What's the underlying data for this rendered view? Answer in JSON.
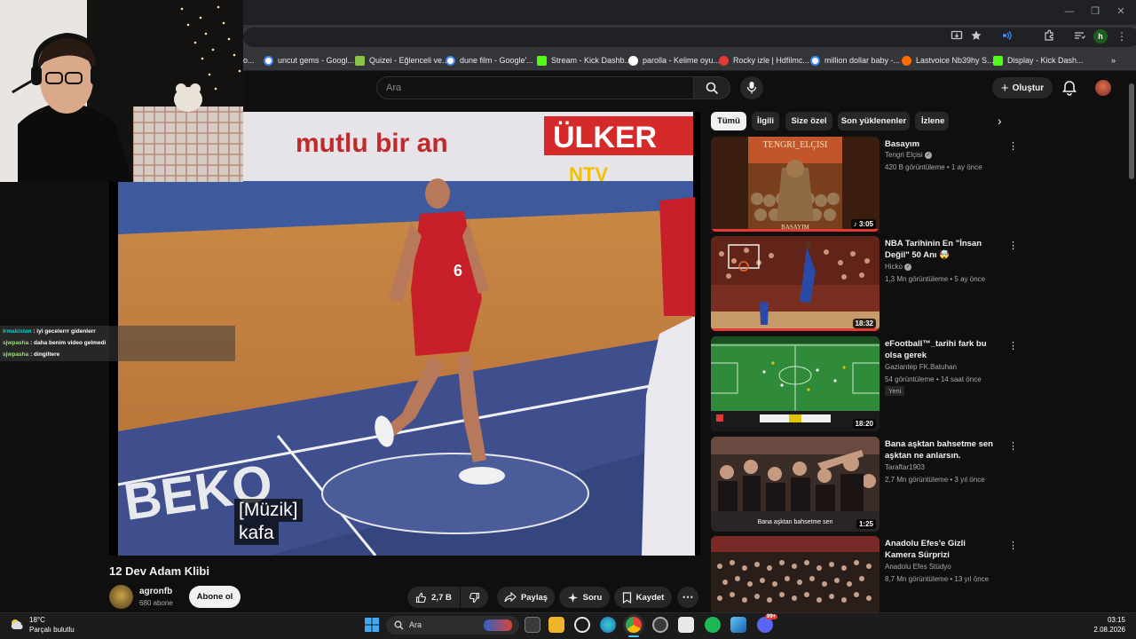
{
  "bookmarks": [
    {
      "label": "uncut gems - Googl...",
      "color": "#4285f4"
    },
    {
      "label": "Quizei - Eğlenceli ve...",
      "color": "#8bc34a"
    },
    {
      "label": "dune film - Google'...",
      "color": "#4285f4"
    },
    {
      "label": "Stream - Kick Dashb...",
      "color": "#53fc18"
    },
    {
      "label": "parolla - Kelime oyu...",
      "color": "#ffffff"
    },
    {
      "label": "Rocky izle | Hdfilmc...",
      "color": "#e53935"
    },
    {
      "label": "million dollar baby -...",
      "color": "#4285f4"
    },
    {
      "label": "Lastvoice Nb39hy S...",
      "color": "#ff6d00"
    },
    {
      "label": "Display - Kick Dash...",
      "color": "#53fc18"
    }
  ],
  "bookmark_prefix": "o...",
  "browser": {
    "profile_letter": "h"
  },
  "header": {
    "search_placeholder": "Ara",
    "create_label": "Oluştur"
  },
  "chat": [
    {
      "user": "Irmakistan",
      "message": " : iyi gecelerrr gidenlerr"
    },
    {
      "user": "sjwpasha",
      "message": " : daha benim video gelmedi"
    },
    {
      "user": "sjwpasha",
      "message": " : dingiltere"
    }
  ],
  "video": {
    "captions": [
      "[Müzik]",
      "kafa"
    ],
    "overlay_texts": [
      "mutlu bir an",
      "ÜLKER",
      "NTV"
    ],
    "title": "12 Dev Adam Klibi",
    "channel": "agronfb",
    "subscribers": "680 abone",
    "subscribe_label": "Abone ol",
    "likes": "2,7 B",
    "share_label": "Paylaş",
    "ask_label": "Soru",
    "save_label": "Kaydet"
  },
  "chips": [
    "Tümü",
    "İlgili",
    "Size özel",
    "Son yüklenenler",
    "İzlene"
  ],
  "recommendations": [
    {
      "title": "Basayım",
      "channel": "Tengri Elçisi",
      "verified": true,
      "meta": "420 B görüntüleme • 1 ay önce",
      "duration": "3:05",
      "music": true,
      "thumb_text": "TENGRI_ELÇISI",
      "thumb_subtext": "BASAYIM",
      "badge": ""
    },
    {
      "title": "NBA Tarihinin En \"İnsan Değil\" 50 Anı 🤯",
      "channel": "Hicko",
      "verified": true,
      "meta": "1,3 Mn görüntüleme • 5 ay önce",
      "duration": "18:32",
      "music": false,
      "badge": ""
    },
    {
      "title": "eFootball™_tarihi fark bu olsa gerek",
      "channel": "Gaziantep FK.Batuhan",
      "verified": false,
      "meta": "54 görüntüleme • 14 saat önce",
      "duration": "18:20",
      "music": false,
      "badge": "Yeni"
    },
    {
      "title": "Bana aşktan bahsetme sen aşktan ne anlarsın.",
      "channel": "Taraftar1903",
      "verified": false,
      "meta": "2,7 Mn görüntüleme • 3 yıl önce",
      "duration": "1:25",
      "music": false,
      "thumb_text": "Bana aşktan bahsetme sen",
      "badge": ""
    },
    {
      "title": "Anadolu Efes'e Gizli Kamera Sürprizi",
      "channel": "Anadolu Efes Stüdyo",
      "verified": false,
      "meta": "8,7 Mn görüntüleme • 13 yıl önce",
      "duration": "",
      "music": false,
      "badge": ""
    }
  ],
  "taskbar": {
    "temperature": "18°C",
    "weather": "Parçalı bulutlu",
    "search": "Ara",
    "time": "03:15",
    "date": "2.08.2026",
    "notification_count": "99+"
  }
}
